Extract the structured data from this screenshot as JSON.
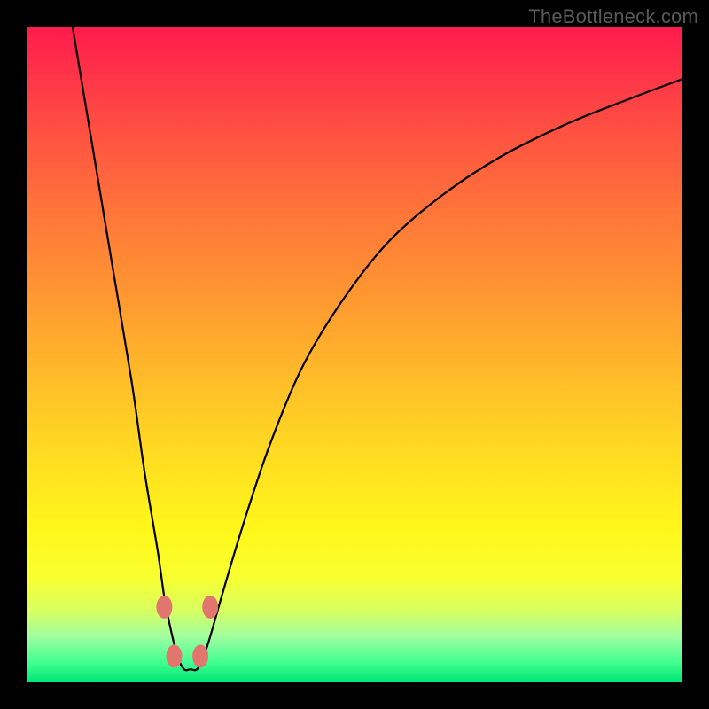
{
  "watermark": "TheBottleneck.com",
  "chart_data": {
    "type": "line",
    "title": "",
    "xlabel": "",
    "ylabel": "",
    "xlim": [
      0,
      100
    ],
    "ylim": [
      0,
      100
    ],
    "grid": false,
    "series": [
      {
        "name": "bottleneck-curve",
        "x": [
          7,
          10,
          13,
          16,
          18,
          20,
          21,
          22,
          23,
          24,
          25,
          26,
          27,
          28,
          30,
          33,
          37,
          42,
          48,
          55,
          63,
          72,
          82,
          92,
          100
        ],
        "y": [
          100,
          82,
          64,
          46,
          32,
          20,
          13,
          8,
          4,
          2,
          2,
          2,
          4,
          7,
          14,
          24,
          36,
          48,
          58,
          67,
          74,
          80,
          85,
          89,
          92
        ]
      }
    ],
    "markers": [
      {
        "name": "left-upper",
        "x": 21.0,
        "y": 11.5
      },
      {
        "name": "left-lower",
        "x": 22.5,
        "y": 4.0
      },
      {
        "name": "right-lower",
        "x": 26.5,
        "y": 4.0
      },
      {
        "name": "right-upper",
        "x": 28.0,
        "y": 11.5
      }
    ],
    "marker_color": "#e2766e",
    "curve_color": "#000000"
  }
}
